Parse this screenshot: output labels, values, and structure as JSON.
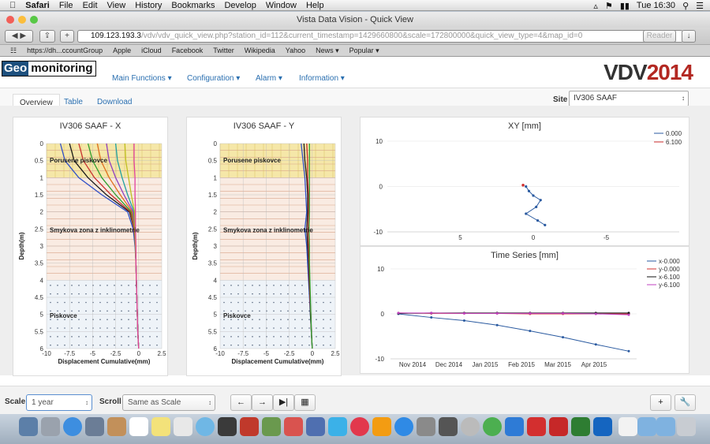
{
  "menubar": {
    "app": "Safari",
    "items": [
      "File",
      "Edit",
      "View",
      "History",
      "Bookmarks",
      "Develop",
      "Window",
      "Help"
    ],
    "clock": "Tue 16:30"
  },
  "window": {
    "title": "Vista Data Vision - Quick View"
  },
  "toolbar": {
    "url_host": "109.123.193.3",
    "url_path": "/vdv/vdv_quick_view.php?station_id=112&current_timestamp=1429660800&scale=172800000&quick_view_type=4&map_id=0",
    "reader": "Reader"
  },
  "bookmarks": [
    "https://dh...ccountGroup",
    "Apple",
    "iCloud",
    "Facebook",
    "Twitter",
    "Wikipedia",
    "Yahoo",
    "News ▾",
    "Popular ▾"
  ],
  "header": {
    "logo_a": "Geo",
    "logo_b": "monitoring",
    "nav": [
      "Main Functions",
      "Configuration",
      "Alarm",
      "Information"
    ],
    "brand_a": "VDV",
    "brand_b": "2014"
  },
  "tabs": [
    "Overview",
    "Table",
    "Download"
  ],
  "site": {
    "label": "Site",
    "value": "IV306 SAAF"
  },
  "chart_x": {
    "title": "IV306 SAAF - X",
    "ylabel": "Depth(m)",
    "xlabel": "Displacement Cumulative(mm)",
    "yticks": [
      "0",
      "0.5",
      "1",
      "1.5",
      "2",
      "2.5",
      "3",
      "3.5",
      "4",
      "4.5",
      "5",
      "5.5",
      "6"
    ],
    "xticks": [
      "-10",
      "-7.5",
      "-5",
      "-2.5",
      "0",
      "2.5"
    ],
    "zones": [
      "Porusene piskovce",
      "Smykova zona z inklinometrie",
      "Piskovce"
    ]
  },
  "chart_y": {
    "title": "IV306 SAAF - Y",
    "ylabel": "Depth(m)",
    "xlabel": "Displacement Cumulative(mm)",
    "yticks": [
      "0",
      "0.5",
      "1",
      "1.5",
      "2",
      "2.5",
      "3",
      "3.5",
      "4",
      "4.5",
      "5",
      "5.5",
      "6"
    ],
    "xticks": [
      "-10",
      "-7.5",
      "-5",
      "-2.5",
      "0",
      "2.5"
    ],
    "zones": [
      "Porusene piskovce",
      "Smykova zona z inklinometrie",
      "Piskovce"
    ]
  },
  "chart_xy": {
    "title": "XY [mm]",
    "yticks": [
      "10",
      "0",
      "-10"
    ],
    "xticks": [
      "5",
      "0",
      "-5"
    ],
    "legend": [
      "0.000",
      "6.100"
    ]
  },
  "chart_ts": {
    "title": "Time Series [mm]",
    "yticks": [
      "10",
      "0",
      "-10"
    ],
    "xticks": [
      "Nov 2014",
      "Dec 2014",
      "Jan 2015",
      "Feb 2015",
      "Mar 2015",
      "Apr 2015"
    ],
    "legend": [
      "x-0.000",
      "y-0.000",
      "x-6.100",
      "y-6.100"
    ]
  },
  "chart_data": [
    {
      "type": "line",
      "title": "IV306 SAAF - X",
      "xlabel": "Displacement Cumulative(mm)",
      "ylabel": "Depth(m)",
      "xlim": [
        -10,
        2.5
      ],
      "ylim": [
        6,
        0
      ],
      "depths": [
        0,
        0.5,
        1,
        1.5,
        2,
        2.5,
        3,
        3.5,
        4,
        4.5,
        5,
        5.5,
        6
      ],
      "series": [
        {
          "values": [
            -8.5,
            -8,
            -6.5,
            -4,
            -1.2,
            -0.6,
            -0.4,
            -0.3,
            -0.25,
            -0.2,
            -0.15,
            -0.1,
            0
          ]
        },
        {
          "values": [
            -7.5,
            -7,
            -5.5,
            -3.5,
            -1,
            -0.5,
            -0.35,
            -0.3,
            -0.25,
            -0.2,
            -0.15,
            -0.1,
            0
          ]
        },
        {
          "values": [
            -6.5,
            -6,
            -4.8,
            -3,
            -0.9,
            -0.5,
            -0.35,
            -0.3,
            -0.25,
            -0.2,
            -0.15,
            -0.1,
            0
          ]
        },
        {
          "values": [
            -5.5,
            -5,
            -4,
            -2.5,
            -0.8,
            -0.45,
            -0.35,
            -0.3,
            -0.25,
            -0.2,
            -0.15,
            -0.1,
            0
          ]
        },
        {
          "values": [
            -4.5,
            -4.1,
            -3.2,
            -2,
            -0.7,
            -0.45,
            -0.35,
            -0.3,
            -0.25,
            -0.2,
            -0.15,
            -0.1,
            0
          ]
        },
        {
          "values": [
            -3.5,
            -3.2,
            -2.5,
            -1.6,
            -0.6,
            -0.4,
            -0.35,
            -0.3,
            -0.25,
            -0.2,
            -0.15,
            -0.1,
            0
          ]
        },
        {
          "values": [
            -2.5,
            -2.3,
            -1.8,
            -1.2,
            -0.5,
            -0.4,
            -0.35,
            -0.3,
            -0.25,
            -0.2,
            -0.15,
            -0.1,
            0
          ]
        },
        {
          "values": [
            -1.5,
            -1.4,
            -1.1,
            -0.8,
            -0.45,
            -0.4,
            -0.35,
            -0.3,
            -0.25,
            -0.2,
            -0.15,
            -0.1,
            0
          ]
        },
        {
          "values": [
            -0.5,
            -0.5,
            -0.4,
            -0.4,
            -0.35,
            -0.35,
            -0.3,
            -0.3,
            -0.25,
            -0.2,
            -0.15,
            -0.1,
            0
          ]
        }
      ]
    },
    {
      "type": "line",
      "title": "IV306 SAAF - Y",
      "xlabel": "Displacement Cumulative(mm)",
      "ylabel": "Depth(m)",
      "xlim": [
        -10,
        2.5
      ],
      "ylim": [
        6,
        0
      ],
      "depths": [
        0,
        0.5,
        1,
        1.5,
        2,
        2.5,
        3,
        3.5,
        4,
        4.5,
        5,
        5.5,
        6
      ],
      "series": [
        {
          "values": [
            -1.2,
            -1.0,
            -0.8,
            -0.7,
            -0.6,
            -0.8,
            -0.6,
            -0.5,
            -0.4,
            -0.3,
            -0.2,
            -0.1,
            0
          ]
        },
        {
          "values": [
            -0.9,
            -0.8,
            -0.6,
            -0.5,
            -0.5,
            -0.6,
            -0.5,
            -0.4,
            -0.35,
            -0.25,
            -0.2,
            -0.1,
            0
          ]
        },
        {
          "values": [
            -0.6,
            -0.5,
            -0.5,
            -0.4,
            -0.4,
            -0.45,
            -0.4,
            -0.35,
            -0.3,
            -0.25,
            -0.15,
            -0.1,
            0
          ]
        },
        {
          "values": [
            -0.3,
            -0.3,
            -0.3,
            -0.3,
            -0.3,
            -0.35,
            -0.3,
            -0.3,
            -0.25,
            -0.2,
            -0.15,
            -0.1,
            0
          ]
        }
      ]
    },
    {
      "type": "scatter",
      "title": "XY [mm]",
      "xlim": [
        10,
        -10
      ],
      "ylim": [
        -10,
        10
      ],
      "series": [
        {
          "name": "0.000",
          "x": [
            0.5,
            0.3,
            0,
            -0.5,
            -0.2,
            0.5,
            -0.3,
            -0.8
          ],
          "y": [
            0,
            -1,
            -2,
            -3,
            -4.5,
            -6,
            -7.5,
            -8.5
          ]
        },
        {
          "name": "6.100",
          "x": [
            0.7
          ],
          "y": [
            0.3
          ]
        }
      ]
    },
    {
      "type": "line",
      "title": "Time Series [mm]",
      "ylim": [
        -10,
        10
      ],
      "categories": [
        "Nov 2014",
        "Dec 2014",
        "Jan 2015",
        "Feb 2015",
        "Mar 2015",
        "Apr 2015"
      ],
      "series": [
        {
          "name": "x-0.000",
          "values": [
            0,
            -0.8,
            -1.5,
            -2.5,
            -3.8,
            -5.2,
            -6.8,
            -8.3
          ]
        },
        {
          "name": "y-0.000",
          "values": [
            0.2,
            0.1,
            0.1,
            0.1,
            0,
            0,
            0,
            0
          ]
        },
        {
          "name": "x-6.100",
          "values": [
            0.1,
            0.2,
            0.2,
            0.2,
            0.2,
            0.2,
            0.2,
            0.2
          ]
        },
        {
          "name": "y-6.100",
          "values": [
            0.2,
            0.2,
            0.1,
            0.1,
            0.1,
            0.1,
            0,
            -0.2
          ]
        }
      ]
    }
  ],
  "controls": {
    "scale_label": "Scale",
    "scale_value": "1 year",
    "scroll_label": "Scroll",
    "scroll_value": "Same as Scale"
  }
}
